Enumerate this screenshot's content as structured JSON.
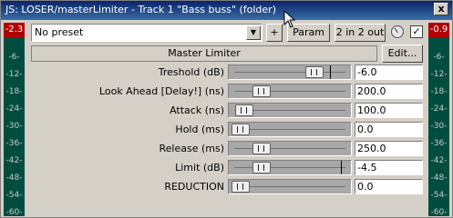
{
  "window": {
    "title": "JS: LOSER/masterLimiter - Track 1 \"Bass buss\" (folder)",
    "close_label": "x"
  },
  "meters": {
    "left_peak": "-2.3",
    "right_peak": "-0.9",
    "ticks": [
      "-6-",
      "-12-",
      "-18-",
      "-24-",
      "-30-",
      "-36-",
      "-42-",
      "-48-",
      "-54-",
      "-60-"
    ]
  },
  "toolbar": {
    "preset_value": "No preset",
    "plus_label": "+",
    "param_label": "Param",
    "io_label": "2 in 2 out",
    "bypass_checked": "✓",
    "edit_label": "Edit..."
  },
  "plugin": {
    "name": "Master Limiter"
  },
  "params": [
    {
      "label": "Treshold (dB)",
      "value": "-6.0",
      "position": 0.7,
      "marker": 0.83
    },
    {
      "label": "Look Ahead [Delay!] (ns)",
      "value": "200.0",
      "position": 0.27
    },
    {
      "label": "Attack (ns)",
      "value": "100.0",
      "position": 0.13
    },
    {
      "label": "Hold (ms)",
      "value": "0.0",
      "position": 0.1
    },
    {
      "label": "Release (ms)",
      "value": "250.0",
      "position": 0.27
    },
    {
      "label": "Limit (dB)",
      "value": "-4.5",
      "position": 0.27,
      "marker": 0.92
    },
    {
      "label": "REDUCTION",
      "value": "0.0",
      "position": 0.1
    }
  ]
}
